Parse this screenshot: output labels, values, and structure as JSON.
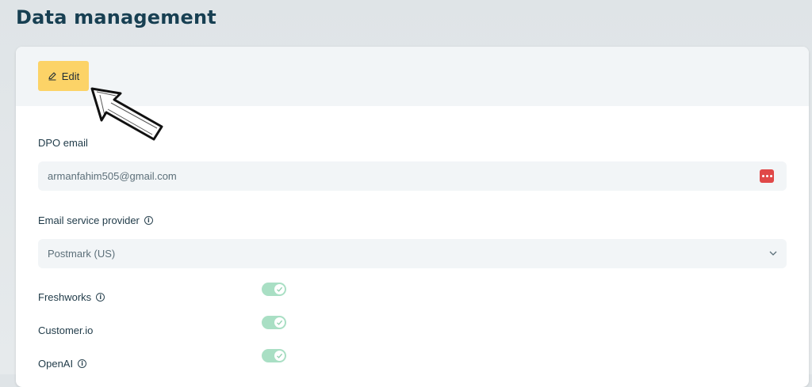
{
  "page": {
    "title": "Data management"
  },
  "toolbar": {
    "edit_label": "Edit"
  },
  "dpo": {
    "label": "DPO email",
    "value": "armanfahim505@gmail.com"
  },
  "email_provider": {
    "label": "Email service provider",
    "selected": "Postmark (US)"
  },
  "integrations": [
    {
      "label": "Freshworks",
      "has_info": true,
      "enabled": true
    },
    {
      "label": "Customer.io",
      "has_info": false,
      "enabled": true
    },
    {
      "label": "OpenAI",
      "has_info": true,
      "enabled": true
    }
  ],
  "icons": {
    "edit": "pencil-icon",
    "info": "info-icon",
    "password_manager": "dots-badge-icon",
    "dropdown": "chevron-down-icon",
    "toggle_check": "check-icon",
    "annotation": "arrow-icon"
  },
  "colors": {
    "edit_button": "#fcd367",
    "toggle_on": "#a9dfc4",
    "password_badge": "#e04848",
    "title": "#173f52"
  }
}
